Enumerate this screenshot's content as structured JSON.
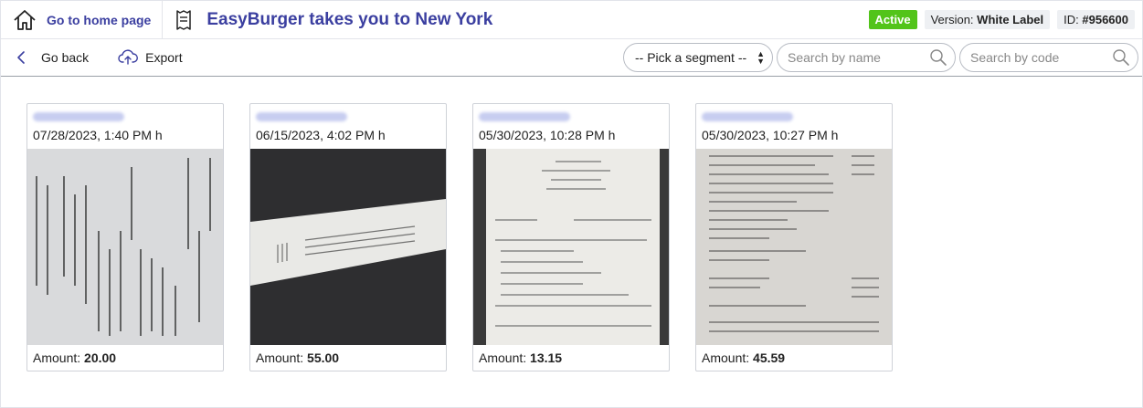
{
  "header": {
    "home_label": "Go to home page",
    "title": "EasyBurger takes you to New York",
    "status": "Active",
    "version_label": "Version:",
    "version_value": "White Label",
    "id_label": "ID:",
    "id_value": "#956600",
    "icons": [
      "home-icon",
      "receipt-icon"
    ]
  },
  "toolbar": {
    "back_label": "Go back",
    "export_label": "Export",
    "segment_value": "-- Pick a segment --",
    "search_name_placeholder": "Search by name",
    "search_code_placeholder": "Search by code",
    "icons": [
      "chevron-left-icon",
      "cloud-upload-icon",
      "search-icon"
    ]
  },
  "colors": {
    "accent": "#3b3fa0",
    "status_active": "#52c41a",
    "chip_bg": "#eef0f3"
  },
  "cards": [
    {
      "date": "07/28/2023, 1:40 PM h",
      "amount_label": "Amount:",
      "amount": "20.00"
    },
    {
      "date": "06/15/2023, 4:02 PM h",
      "amount_label": "Amount:",
      "amount": "55.00"
    },
    {
      "date": "05/30/2023, 10:28 PM h",
      "amount_label": "Amount:",
      "amount": "13.15"
    },
    {
      "date": "05/30/2023, 10:27 PM h",
      "amount_label": "Amount:",
      "amount": "45.59"
    }
  ]
}
